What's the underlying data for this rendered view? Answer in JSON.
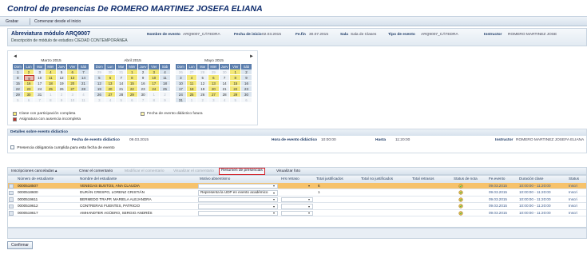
{
  "window": {
    "title": "Control de presencias De ROMERO MARTINEZ JOSEFA ELIANA"
  },
  "toolbar": {
    "save_label": "Grabar",
    "start_label": "Comenzar desde el inicio"
  },
  "header": {
    "abbr": "Abreviatura módulo ARQ9007",
    "description": "Descripción de módulo de estudios CIEDAD CONTEMPORÁNEA",
    "fields": [
      {
        "label": "Nombre de evento",
        "value": "ARQ9007_CÁTEDRA"
      },
      {
        "label": "Fecha de inicio",
        "value": "02.03.2015"
      },
      {
        "label": "Fe.fin",
        "value": "30.07.2015"
      },
      {
        "label": "Sala",
        "value": "Sala de Clases"
      },
      {
        "label": "Tipo de evento",
        "value": "ARQ9007_CÁTEDRA"
      },
      {
        "label": "Instructor",
        "value": "ROMERO MARTINEZ JOSE"
      }
    ]
  },
  "calendar": {
    "prev": "◄",
    "next": "►",
    "months": [
      {
        "title": "Marzo 2015"
      },
      {
        "title": "Abril 2015"
      },
      {
        "title": "Mayo 2015"
      }
    ],
    "weekdays": [
      "Dom",
      "Lun",
      "Mar",
      "Miér",
      "Juev",
      "Vier",
      "Sáb"
    ],
    "legend": {
      "full": "Clase con participación completa",
      "incomplete": "Asignatura con ausencia incompleta",
      "future": "Fecha de evento didáctico futura"
    },
    "colors": {
      "full": "#f3e878",
      "incomplete": "#c1332a",
      "header": "#5c7fae"
    }
  },
  "details": {
    "title": "Detalles sobre evento didáctico",
    "date_label": "Fecha de evento didáctico",
    "date_value": "09.03.2015",
    "checkbox_label": "Presencia obligatoria cumplida para esta fecha de evento",
    "time_label": "Hora de evento didáctico",
    "time_value": "10:00:00",
    "until_label": "Hasta",
    "until_value": "11:20:00",
    "instructor_label": "Instructor",
    "instructor_value": "ROMERO MARTINEZ JOSEFA ELIANA"
  },
  "tabs": [
    {
      "label": "Inscripciones canceladas ▴"
    },
    {
      "label": "Crear el comentario"
    },
    {
      "label": "Modificar el comentario"
    },
    {
      "label": "Visualizar el comentario"
    },
    {
      "label": "Resumen de presencias"
    },
    {
      "label": "Visualizar foto"
    }
  ],
  "table": {
    "columns": [
      "Número de estudiante",
      "Nombre del estudiante",
      "Motivo absentismo",
      "Hrs retraso",
      "Total justificados",
      "Total no justificados",
      "Total retrasos",
      "Status de nota",
      "Fe.evento",
      "Duración clase",
      "Status"
    ],
    "rows": [
      {
        "num": "0000518507",
        "name": "VENEGAS BUSTOS, ANA CLAUDIA",
        "motivo": "",
        "hrs": "",
        "tj": "6",
        "date": "09.03.2015",
        "dur": "10:00:00 - 11:20:00",
        "status": "Inscri"
      },
      {
        "num": "0000518600",
        "name": "DURÁN CRESPO, LORENZ CRISTIÁN",
        "motivo": "Representa la UDP en evento académico",
        "hrs": "",
        "tj": "1",
        "date": "09.03.2015",
        "dur": "10:00:00 - 11:20:00",
        "status": "Inscri"
      },
      {
        "num": "0000519611",
        "name": "BERMEDO TRAPP, MARIELA ALEJANDRA",
        "motivo": "",
        "hrs": "",
        "tj": "",
        "date": "09.03.2015",
        "dur": "10:00:00 - 11:20:00",
        "status": "Inscri"
      },
      {
        "num": "0000519612",
        "name": "CONTRERAS FUENTES, PATRICIO",
        "motivo": "",
        "hrs": "",
        "tj": "",
        "date": "09.03.2015",
        "dur": "10:00:00 - 11:20:00",
        "status": "Inscri"
      },
      {
        "num": "0000519617",
        "name": "AMHANDTER AGÜERO, SERGIO ANDRÉS",
        "motivo": "",
        "hrs": "",
        "tj": "",
        "date": "09.03.2015",
        "dur": "10:00:00 - 11:20:00",
        "status": "Inscri"
      }
    ]
  },
  "confirm_label": "Confirmar"
}
